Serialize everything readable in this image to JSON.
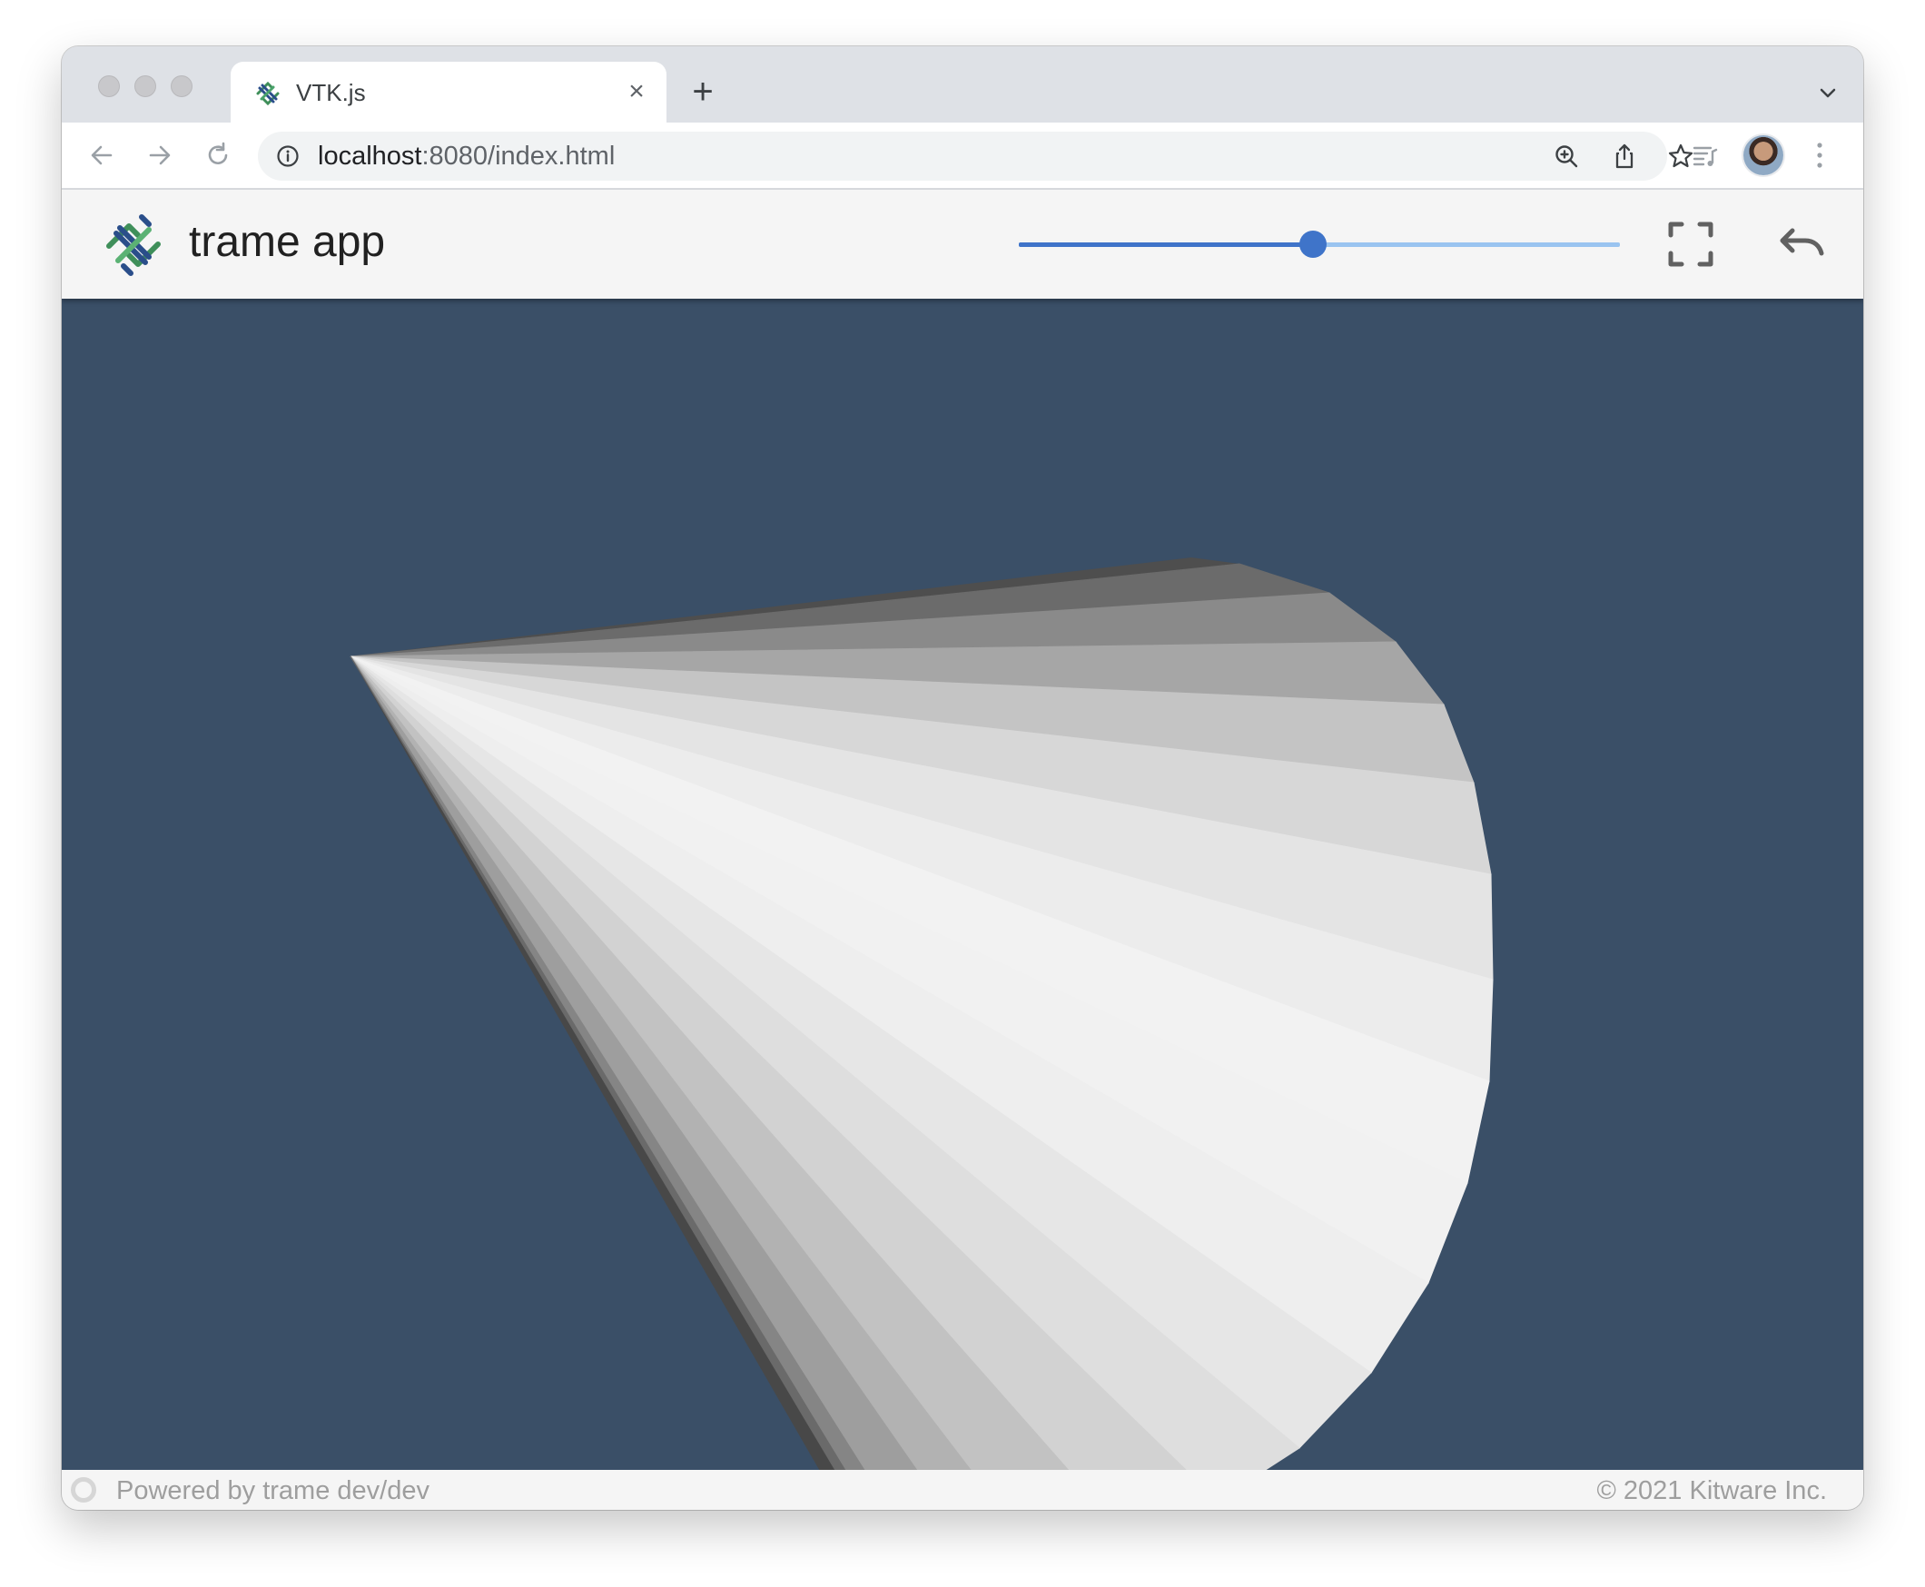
{
  "browser": {
    "tab_title": "VTK.js",
    "new_tab_symbol": "+",
    "close_symbol": "×",
    "url_host": "localhost",
    "url_rest": ":8080/index.html",
    "icons": [
      "back-icon",
      "forward-icon",
      "reload-icon",
      "info-icon",
      "zoom-icon",
      "share-icon",
      "star-icon",
      "reading-list-icon",
      "avatar",
      "menu-icon",
      "tab-list-icon"
    ]
  },
  "app": {
    "title": "trame app",
    "resolution_slider": {
      "value": 0.49
    },
    "buttons": [
      "fullscreen-icon",
      "reset-camera-icon"
    ],
    "viewport_background": "#3a4f67",
    "accent_color": "#3f74c9"
  },
  "footer": {
    "left_text": "Powered by trame dev/dev",
    "right_text": "© 2021 Kitware Inc."
  }
}
